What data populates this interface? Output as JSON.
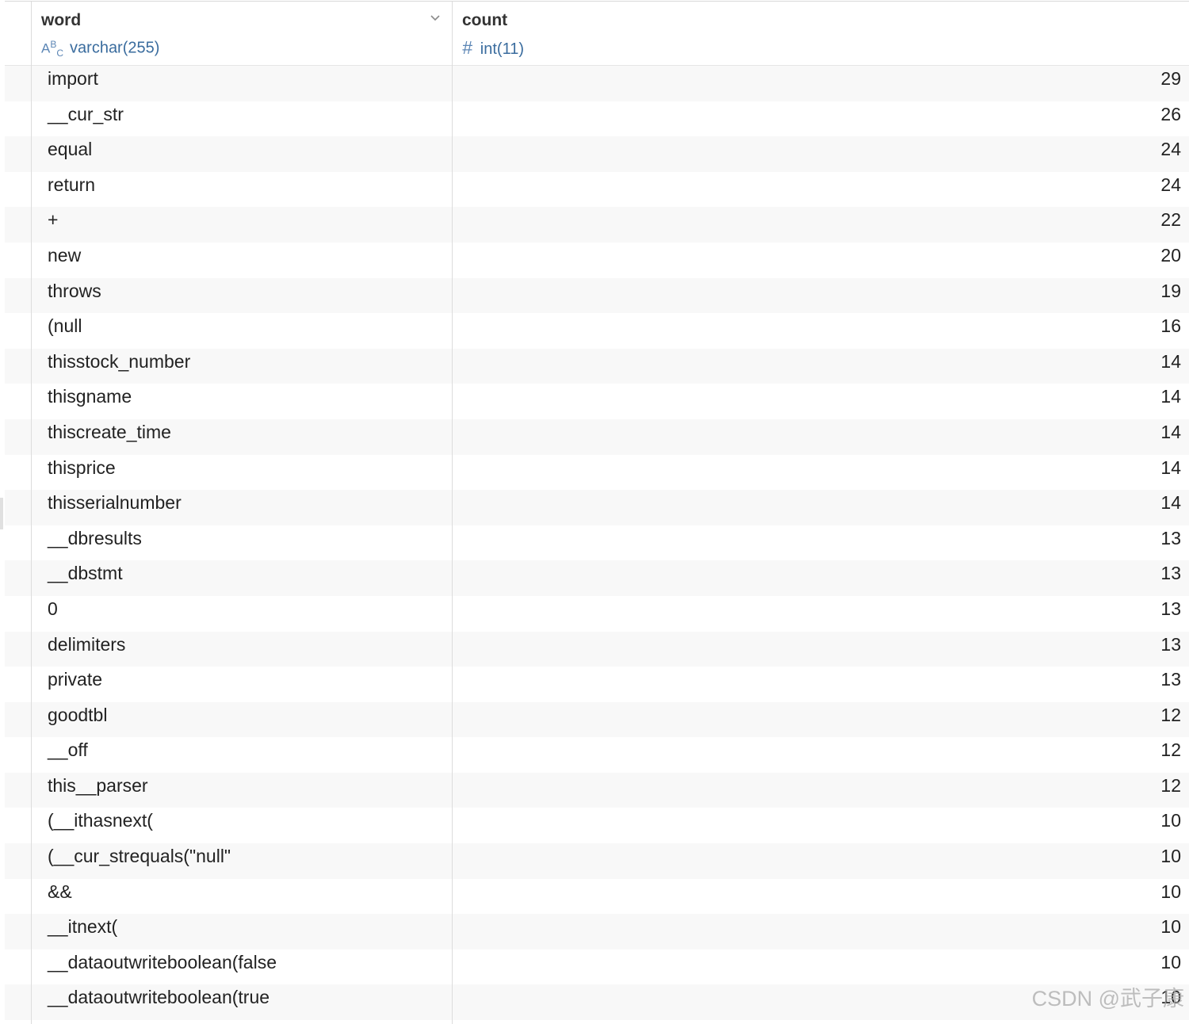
{
  "columns": [
    {
      "name": "word",
      "type": "varchar(255)",
      "type_icon": "abc-text-icon"
    },
    {
      "name": "count",
      "type": "int(11)",
      "type_icon": "hash-number-icon"
    }
  ],
  "rows": [
    {
      "word": "import",
      "count": "29"
    },
    {
      "word": "__cur_str",
      "count": "26"
    },
    {
      "word": "equal",
      "count": "24"
    },
    {
      "word": "return",
      "count": "24"
    },
    {
      "word": "+",
      "count": "22"
    },
    {
      "word": "new",
      "count": "20"
    },
    {
      "word": "throws",
      "count": "19"
    },
    {
      "word": "(null",
      "count": "16"
    },
    {
      "word": "thisstock_number",
      "count": "14"
    },
    {
      "word": "thisgname",
      "count": "14"
    },
    {
      "word": "thiscreate_time",
      "count": "14"
    },
    {
      "word": "thisprice",
      "count": "14"
    },
    {
      "word": "thisserialnumber",
      "count": "14"
    },
    {
      "word": "__dbresults",
      "count": "13"
    },
    {
      "word": "__dbstmt",
      "count": "13"
    },
    {
      "word": "0",
      "count": "13"
    },
    {
      "word": "delimiters",
      "count": "13"
    },
    {
      "word": "private",
      "count": "13"
    },
    {
      "word": "goodtbl",
      "count": "12"
    },
    {
      "word": "__off",
      "count": "12"
    },
    {
      "word": "this__parser",
      "count": "12"
    },
    {
      "word": "(__ithasnext(",
      "count": "10"
    },
    {
      "word": "(__cur_strequals(\"null\"",
      "count": "10"
    },
    {
      "word": "&&",
      "count": "10"
    },
    {
      "word": "__itnext(",
      "count": "10"
    },
    {
      "word": "__dataoutwriteboolean(false",
      "count": "10"
    },
    {
      "word": "__dataoutwriteboolean(true",
      "count": "10"
    }
  ],
  "watermark": "CSDN @武子康"
}
